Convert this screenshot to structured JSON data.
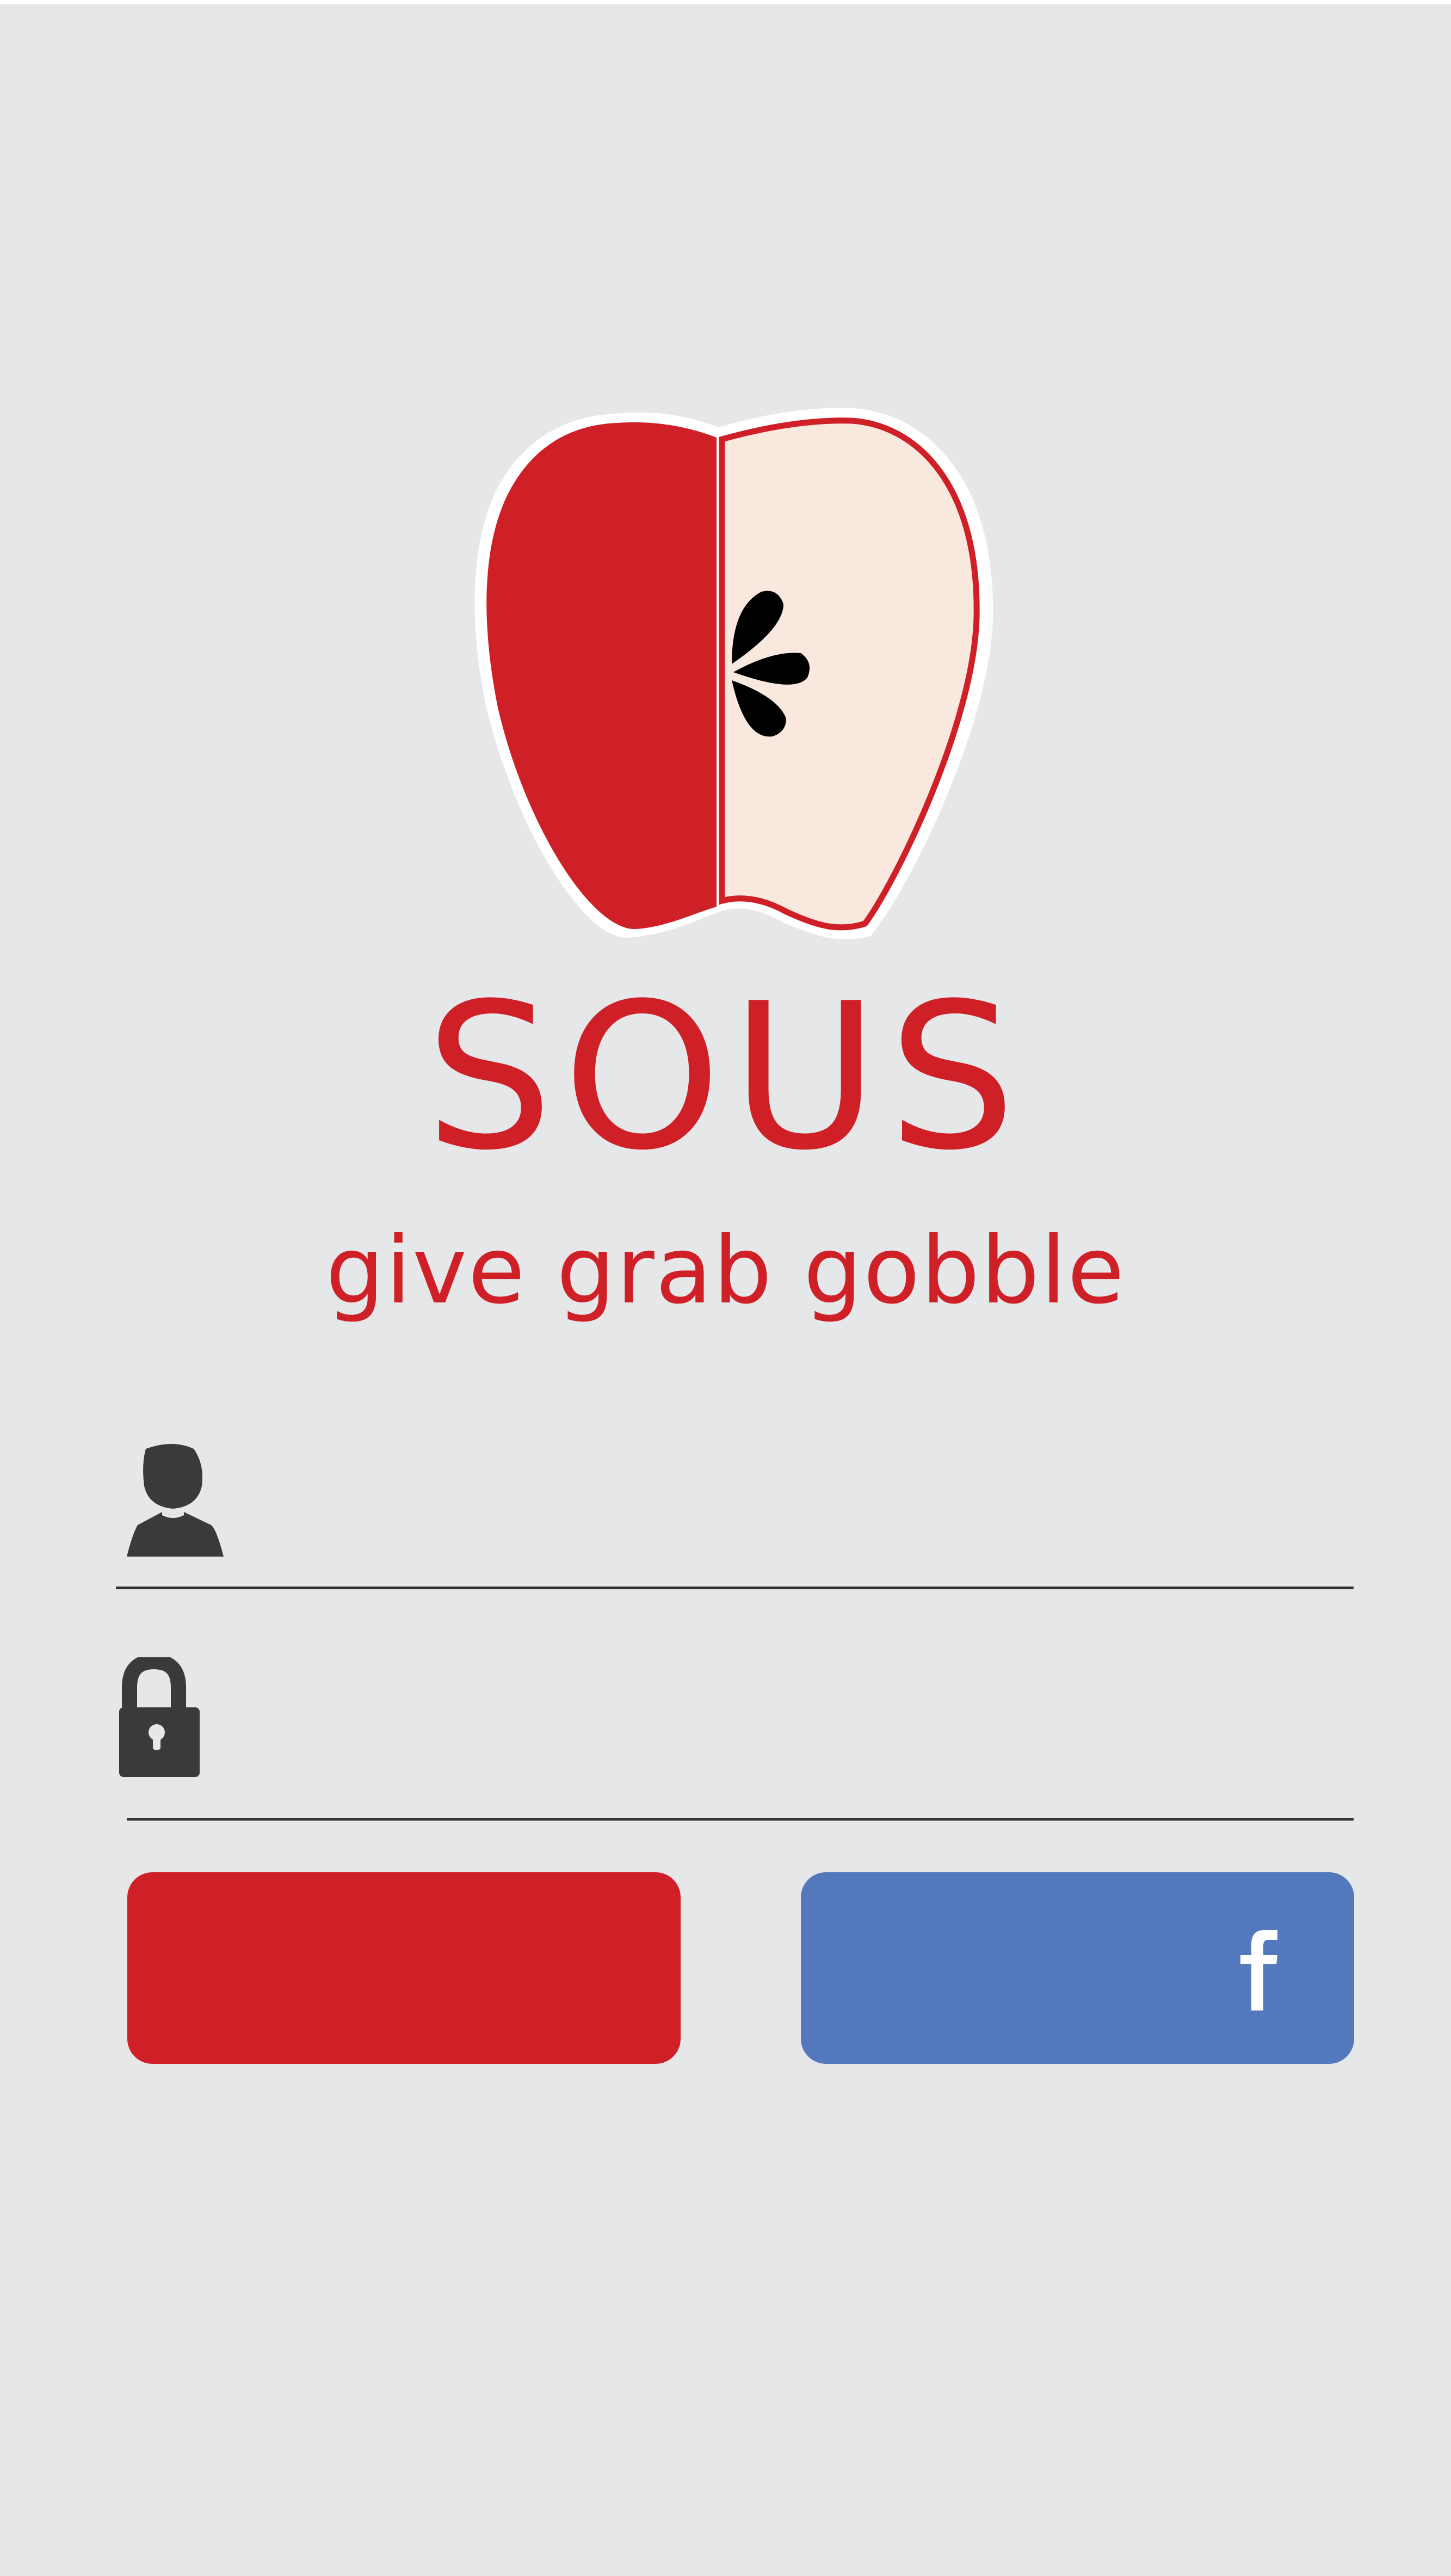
{
  "app": {
    "brand_name": "SOUS",
    "tagline": "give grab gobble"
  },
  "login_form": {
    "username": {
      "icon": "user-icon",
      "value": "",
      "placeholder": ""
    },
    "password": {
      "icon": "lock-icon",
      "value": "",
      "placeholder": ""
    }
  },
  "buttons": {
    "login": {
      "label": "",
      "color": "#cf2028"
    },
    "facebook": {
      "label": "",
      "icon": "facebook-icon",
      "color": "#5378bc"
    }
  },
  "colors": {
    "background": "#e6e7e9",
    "brand_red": "#cf2028",
    "apple_flesh": "#f8e8de",
    "icon_dark": "#3a3a3c",
    "divider": "#333333"
  }
}
